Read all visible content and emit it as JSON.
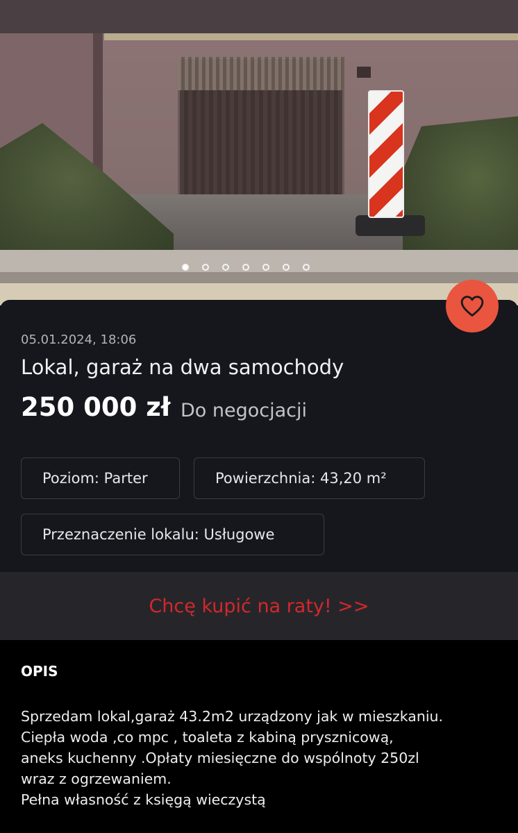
{
  "gallery": {
    "slide_count": 7,
    "active_index": 0
  },
  "listing": {
    "date": "05.01.2024, 18:06",
    "title": "Lokal, garaż na dwa samochody",
    "price": "250 000 zł",
    "price_note": "Do negocjacji"
  },
  "params": {
    "level": "Poziom: Parter",
    "area": "Powierzchnia: 43,20 m²",
    "purpose": "Przeznaczenie lokalu: Usługowe"
  },
  "cta": {
    "label": "Chcę kupić na raty! >>"
  },
  "description": {
    "heading": "OPIS",
    "lines": [
      "Sprzedam lokal,garaż 43.2m2 urządzony jak w mieszkaniu.",
      "Ciepła woda ,co mpc , toaleta z kabiną prysznicową,",
      "aneks kuchenny .Opłaty miesięczne do wspólnoty 250zl",
      "wraz z ogrzewaniem.",
      "Pełna własność z księgą wieczystą"
    ]
  },
  "icons": {
    "favorite": "heart-icon"
  },
  "colors": {
    "accent": "#e9553f",
    "cta_text": "#d2282d",
    "card_bg": "#16161d"
  }
}
